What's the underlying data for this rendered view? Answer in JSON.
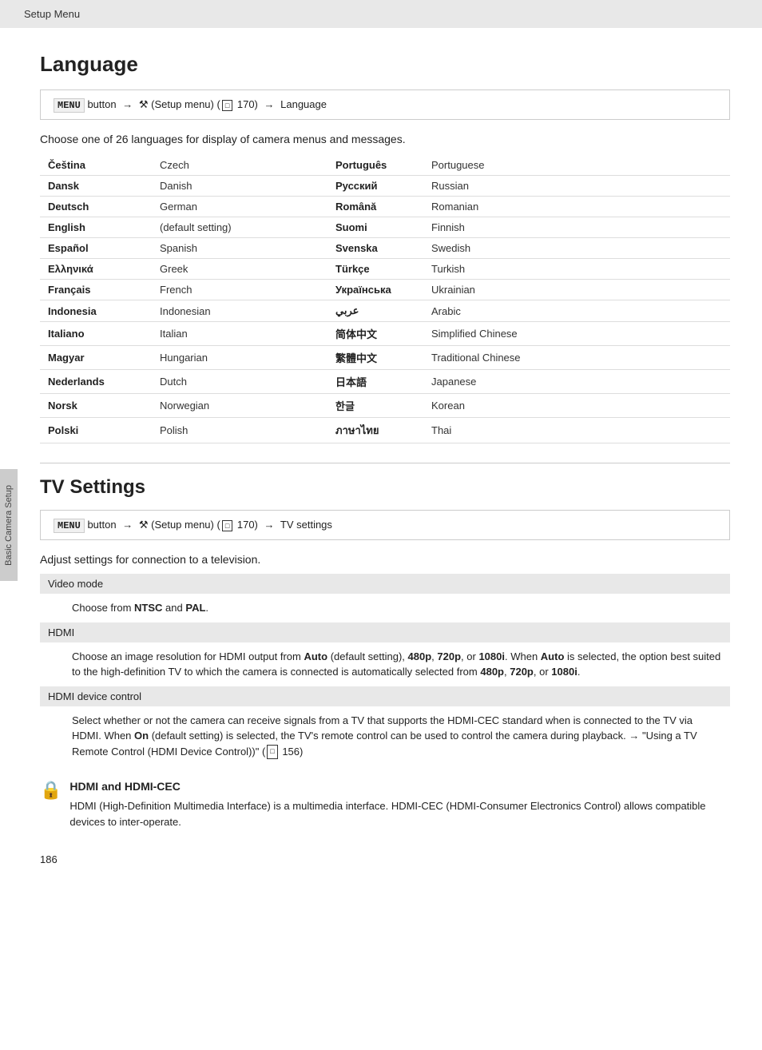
{
  "header": {
    "label": "Setup Menu"
  },
  "sidebar": {
    "label": "Basic Camera Setup"
  },
  "language_section": {
    "title": "Language",
    "menu_path": {
      "keyword": "MENU",
      "button_text": "button",
      "arrow1": "→",
      "wrench": "Y",
      "setup_text": "(Setup menu) (",
      "page_ref": "170",
      "close_paren": ")",
      "arrow2": "→",
      "destination": "Language"
    },
    "intro": "Choose one of 26 languages for display of camera menus and messages.",
    "languages_left": [
      {
        "native": "Čeština",
        "english": "Czech"
      },
      {
        "native": "Dansk",
        "english": "Danish"
      },
      {
        "native": "Deutsch",
        "english": "German"
      },
      {
        "native": "English",
        "english": "(default setting)"
      },
      {
        "native": "Español",
        "english": "Spanish"
      },
      {
        "native": "Ελληνικά",
        "english": "Greek"
      },
      {
        "native": "Français",
        "english": "French"
      },
      {
        "native": "Indonesia",
        "english": "Indonesian"
      },
      {
        "native": "Italiano",
        "english": "Italian"
      },
      {
        "native": "Magyar",
        "english": "Hungarian"
      },
      {
        "native": "Nederlands",
        "english": "Dutch"
      },
      {
        "native": "Norsk",
        "english": "Norwegian"
      },
      {
        "native": "Polski",
        "english": "Polish"
      }
    ],
    "languages_right": [
      {
        "native": "Português",
        "english": "Portuguese"
      },
      {
        "native": "Русский",
        "english": "Russian"
      },
      {
        "native": "Română",
        "english": "Romanian"
      },
      {
        "native": "Suomi",
        "english": "Finnish"
      },
      {
        "native": "Svenska",
        "english": "Swedish"
      },
      {
        "native": "Türkçe",
        "english": "Turkish"
      },
      {
        "native": "Українська",
        "english": "Ukrainian"
      },
      {
        "native": "عربي",
        "english": "Arabic"
      },
      {
        "native": "简体中文",
        "english": "Simplified Chinese"
      },
      {
        "native": "繁體中文",
        "english": "Traditional Chinese"
      },
      {
        "native": "日本語",
        "english": "Japanese"
      },
      {
        "native": "한글",
        "english": "Korean"
      },
      {
        "native": "ภาษาไทย",
        "english": "Thai"
      }
    ]
  },
  "tv_section": {
    "title": "TV Settings",
    "menu_path": {
      "keyword": "MENU",
      "button_text": "button",
      "arrow1": "→",
      "wrench": "Y",
      "setup_text": "(Setup menu) (",
      "page_ref": "170",
      "close_paren": ")",
      "arrow2": "→",
      "destination": "TV settings"
    },
    "intro": "Adjust settings for connection to a television.",
    "subsections": [
      {
        "title": "Video mode",
        "body": "Choose from <b>NTSC</b> and <b>PAL</b>.",
        "body_plain": "Choose from NTSC and PAL.",
        "bold_words": [
          "NTSC",
          "PAL"
        ]
      },
      {
        "title": "HDMI",
        "body": "Choose an image resolution for HDMI output from Auto (default setting), 480p, 720p, or 1080i. When Auto is selected, the option best suited to the high-definition TV to which the camera is connected is automatically selected from 480p, 720p, or 1080i.",
        "bold_words": [
          "Auto",
          "480p",
          "720p",
          "1080i",
          "Auto",
          "480p",
          "720p",
          "1080i"
        ]
      },
      {
        "title": "HDMI device control",
        "body": "Select whether or not the camera can receive signals from a TV that supports the HDMI-CEC standard when is connected to the TV via HDMI. When On (default setting) is selected, the TV's remote control can be used to control the camera during playback. → \"Using a TV Remote Control (HDMI Device Control))\" ( 156)",
        "bold_words": [
          "On"
        ]
      }
    ]
  },
  "note": {
    "icon": "🔒",
    "title": "HDMI and HDMI-CEC",
    "body": "HDMI (High-Definition Multimedia Interface) is a multimedia interface. HDMI-CEC (HDMI-Consumer Electronics Control) allows compatible devices to inter-operate."
  },
  "page_number": "186"
}
